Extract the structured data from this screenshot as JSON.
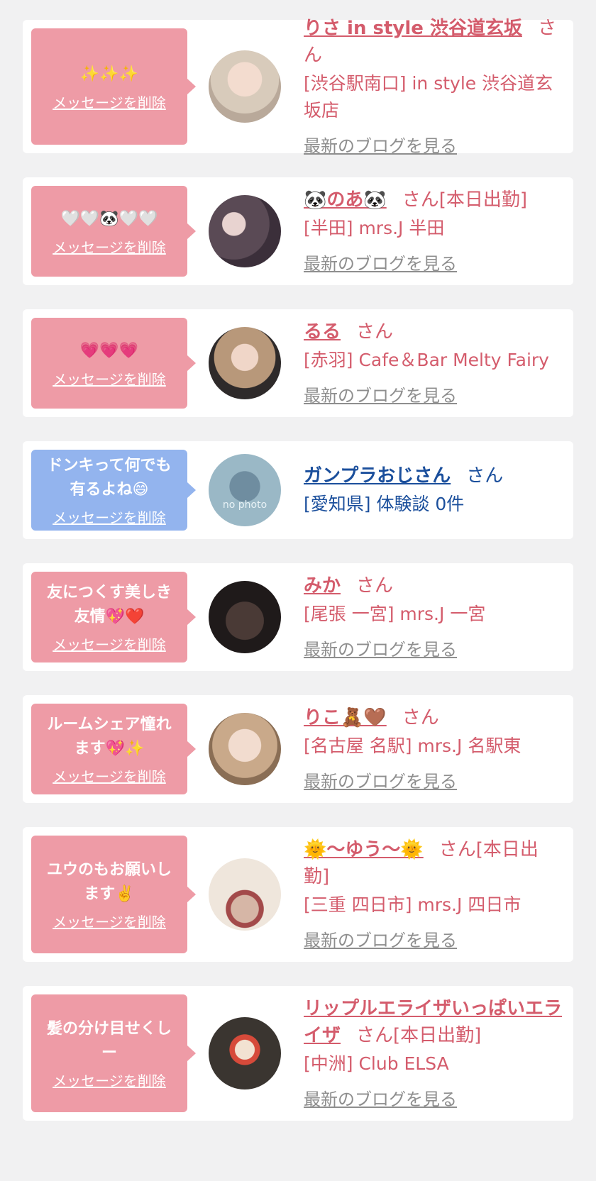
{
  "delete_label": "メッセージを削除",
  "blog_label": "最新のブログを見る",
  "san": "さん",
  "colors": {
    "page_bg": "#f1f1f2",
    "bubble_pink": "#ee9ba6",
    "bubble_blue": "#93b4ee",
    "name_pink": "#d45c6c",
    "name_blue": "#1b4f9c",
    "link_gray": "#8e8e8e"
  },
  "items": [
    {
      "message": "✨✨✨",
      "name": "りさ in style 渋谷道玄坂",
      "suffix": "さん",
      "shop": "[渋谷駅南口] in style 渋谷道玄坂店",
      "show_blog": true,
      "avatar_icon": "photo-avatar"
    },
    {
      "message": "🤍🤍🐼🤍🤍",
      "name": "🐼のあ🐼",
      "suffix": "さん[本日出勤]",
      "shop": "[半田] mrs.J 半田",
      "show_blog": true,
      "avatar_icon": "photo-avatar"
    },
    {
      "message": "💗💗💗",
      "name": "るる",
      "suffix": "さん",
      "shop": "[赤羽] Cafe＆Bar Melty Fairy",
      "show_blog": true,
      "avatar_icon": "photo-avatar"
    },
    {
      "message": "ドンキって何でも\n有るよね😄",
      "name": "ガンプラおじさん",
      "suffix": "さん",
      "shop": "[愛知県] 体験談 0件",
      "show_blog": false,
      "avatar_icon": "no-photo-avatar",
      "avatar_text": "no photo"
    },
    {
      "message": "友につくす美しき\n友情💖❤️",
      "name": "みか",
      "suffix": "さん",
      "shop": "[尾張 一宮] mrs.J 一宮",
      "show_blog": true,
      "avatar_icon": "photo-avatar"
    },
    {
      "message": "ルームシェア憧れ\nます💖✨",
      "name": "りこ🧸🤎",
      "suffix": "さん",
      "shop": "[名古屋 名駅] mrs.J 名駅東",
      "show_blog": true,
      "avatar_icon": "photo-avatar"
    },
    {
      "message": "ユウのもお願いし\nます✌️",
      "name": "🌞〜ゆう〜🌞",
      "suffix": "さん[本日出勤]",
      "shop": "[三重 四日市] mrs.J 四日市",
      "show_blog": true,
      "avatar_icon": "photo-avatar"
    },
    {
      "message": "髪の分け目せくし\nー",
      "name": "リップルエライザいっぱいエライザ",
      "suffix": "さん[本日出勤]",
      "shop": "[中洲] Club ELSA",
      "show_blog": true,
      "avatar_icon": "photo-avatar"
    }
  ]
}
